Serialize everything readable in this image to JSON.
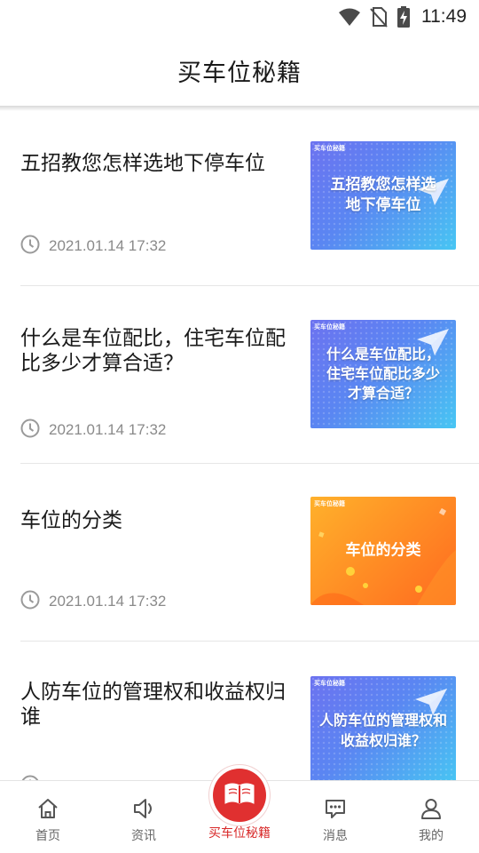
{
  "status_bar": {
    "time": "11:49",
    "icons": [
      "wifi-icon",
      "no-sim-icon",
      "battery-charging-icon"
    ]
  },
  "header": {
    "title": "买车位秘籍"
  },
  "articles": [
    {
      "title": "五招教您怎样选地下停车位",
      "date": "2021.01.14 17:32",
      "thumbnail": {
        "brand": "买车位秘籍",
        "text": "五招教您怎样选地下停车位",
        "style": "blue"
      }
    },
    {
      "title": "什么是车位配比，住宅车位配比多少才算合适？",
      "date": "2021.01.14 17:32",
      "thumbnail": {
        "brand": "买车位秘籍",
        "text": "什么是车位配比，住宅车位配比多少才算合适？",
        "style": "blue"
      }
    },
    {
      "title": "车位的分类",
      "date": "2021.01.14 17:32",
      "thumbnail": {
        "brand": "买车位秘籍",
        "text": "车位的分类",
        "style": "orange"
      }
    },
    {
      "title": "人防车位的管理权和收益权归谁",
      "date": "",
      "thumbnail": {
        "brand": "买车位秘籍",
        "text": "人防车位的管理权和收益权归谁？",
        "style": "blue"
      }
    }
  ],
  "bottom_nav": {
    "items": [
      {
        "label": "首页",
        "icon": "home-icon"
      },
      {
        "label": "资讯",
        "icon": "speaker-icon"
      },
      {
        "label": "买车位秘籍",
        "icon": "book-icon",
        "active": true
      },
      {
        "label": "消息",
        "icon": "message-icon"
      },
      {
        "label": "我的",
        "icon": "user-icon"
      }
    ]
  },
  "colors": {
    "accent": "#e03030",
    "active_label": "#d82a2a",
    "date_text": "#8a8a8a",
    "divider": "#e6e6e6"
  }
}
